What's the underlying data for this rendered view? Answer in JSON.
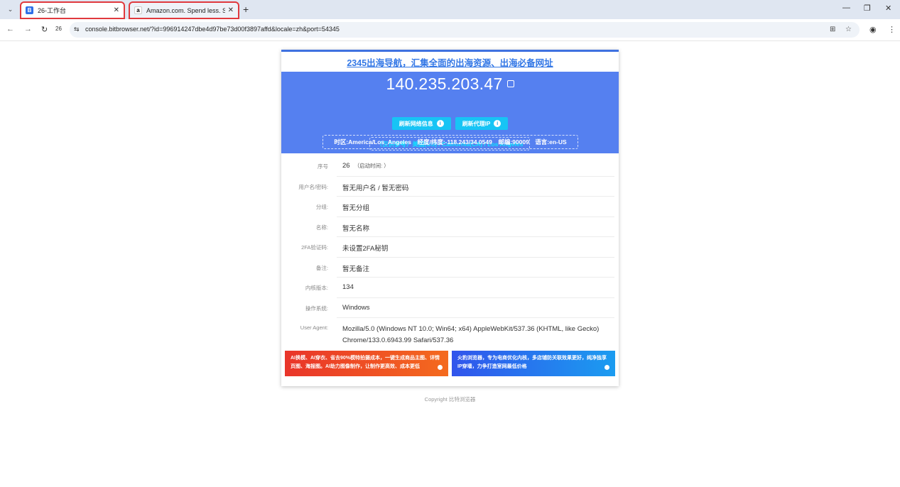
{
  "browser": {
    "tabs": [
      {
        "title": "26-工作台",
        "favicon": "bitbrowser-icon"
      },
      {
        "title": "Amazon.com. Spend less. Smile",
        "favicon": "amazon-icon"
      }
    ],
    "tab_count": "26",
    "url": "console.bitbrowser.net/?id=996914247dbe4d97be73d00f3897affd&locale=zh&port=54345"
  },
  "page": {
    "nav_link": "2345出海导航，汇集全面的出海资源、出海必备网址",
    "ip": "140.235.203.47",
    "btn_refresh_network": "刷新网络信息",
    "btn_refresh_proxy": "刷新代理IP",
    "geo": "（仅供参考）美国(US) / California(CA) / Los Angeles",
    "tz_line": "时区:America/Los_Angeles　经度/纬度:-118.243/34.0549　邮编:90009　语言:en-US",
    "rows": [
      {
        "k": "序号",
        "v": "26",
        "sub": "（启动时间: ）"
      },
      {
        "k": "用户名/密码:",
        "v": "暂无用户名 / 暂无密码"
      },
      {
        "k": "分组:",
        "v": "暂无分组"
      },
      {
        "k": "名称:",
        "v": "暂无名称"
      },
      {
        "k": "2FA验证码:",
        "v": "未设置2FA秘钥"
      },
      {
        "k": "备注:",
        "v": "暂无备注"
      },
      {
        "k": "内核版本:",
        "v": "134"
      },
      {
        "k": "操作系统:",
        "v": "Windows"
      },
      {
        "k": "User Agent:",
        "v": "Mozilla/5.0 (Windows NT 10.0; Win64; x64) AppleWebKit/537.36 (KHTML, like Gecko) Chrome/133.0.6943.99 Safari/537.36"
      }
    ],
    "banner_left": "AI换模、AI穿衣、省去90%模特拍摄成本，一键生成商品主图、详情页图、海报图。AI助力图像制作，让制作更高效、成本更低",
    "banner_right": "火豹浏览器，专为电商优化内核，多店铺防关联效果更好，纯净独享IP穿墙，力争打造室网最低价格",
    "footer": "Copyright 比特浏览器"
  },
  "colors": {
    "hero_bg": "#5580f0",
    "accent_link": "#3478e6",
    "tab_highlight": "#e0393e"
  }
}
